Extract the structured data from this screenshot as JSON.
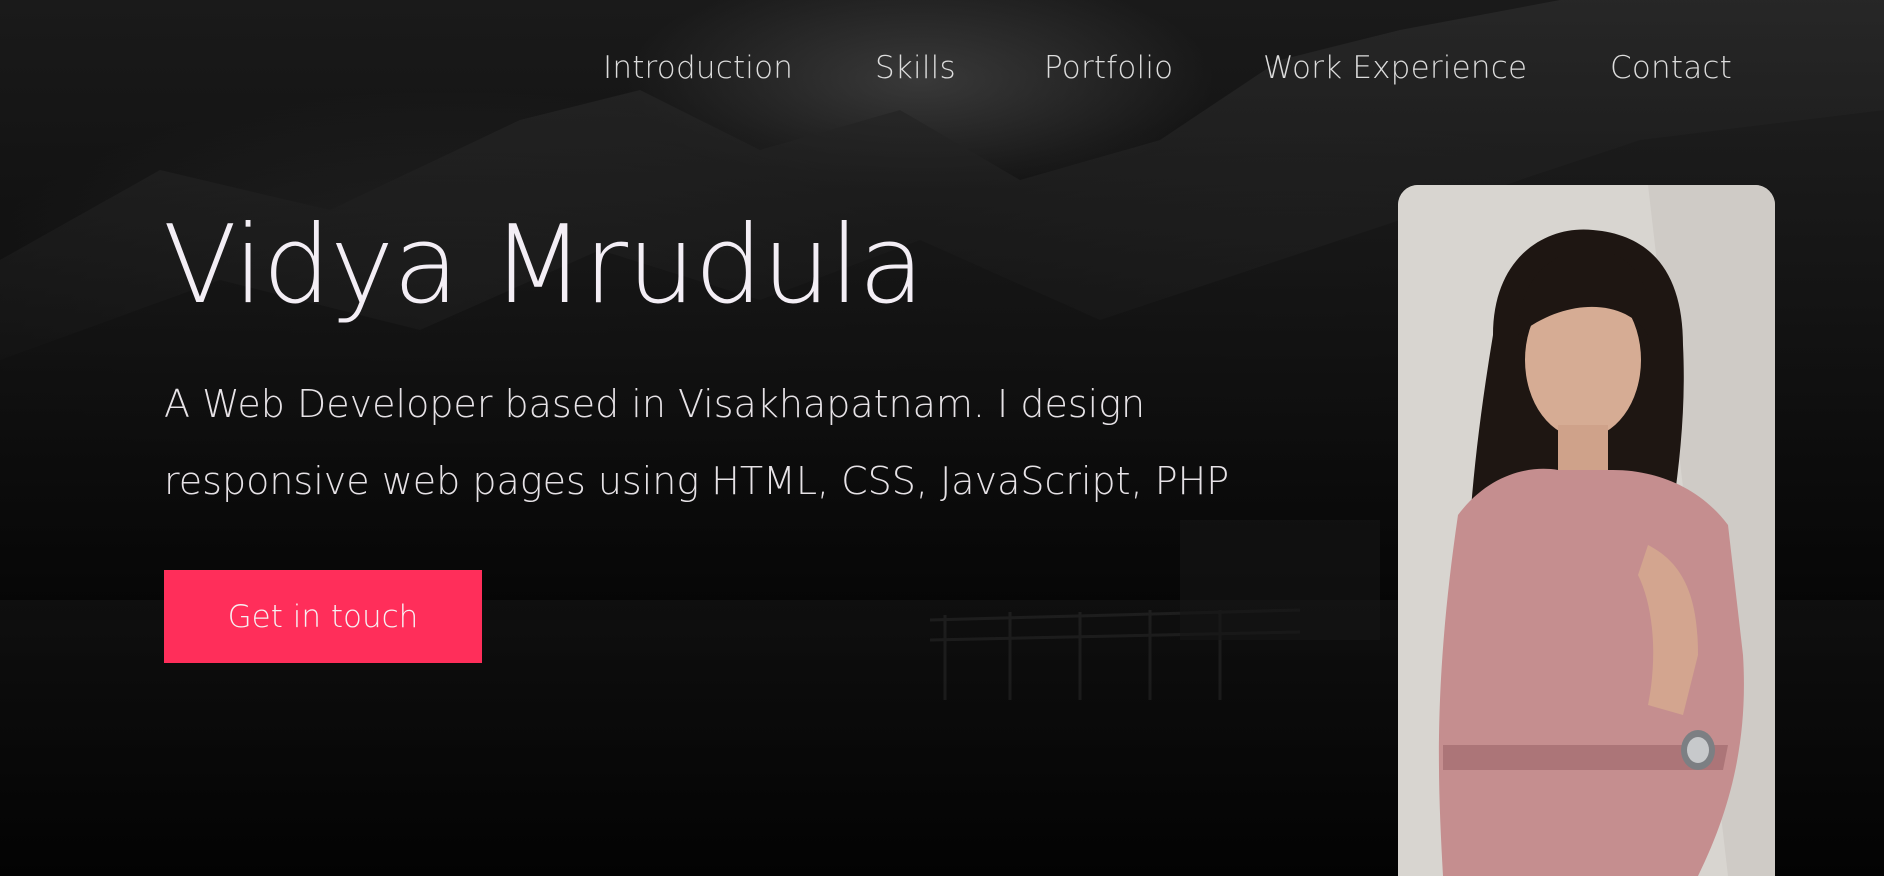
{
  "nav": {
    "items": [
      {
        "label": "Introduction"
      },
      {
        "label": "Skills"
      },
      {
        "label": "Portfolio"
      },
      {
        "label": "Work Experience"
      },
      {
        "label": "Contact"
      }
    ]
  },
  "hero": {
    "title": "Vidya Mrudula",
    "description": "A Web Developer based in Visakhapatnam. I design responsive web pages using HTML, CSS, JavaScript, PHP",
    "cta_label": "Get in touch"
  },
  "profile": {
    "image_icon": "profile-photo-icon"
  },
  "colors": {
    "accent": "#ff2e5a",
    "background": "#050505",
    "text": "#f3eef5"
  }
}
